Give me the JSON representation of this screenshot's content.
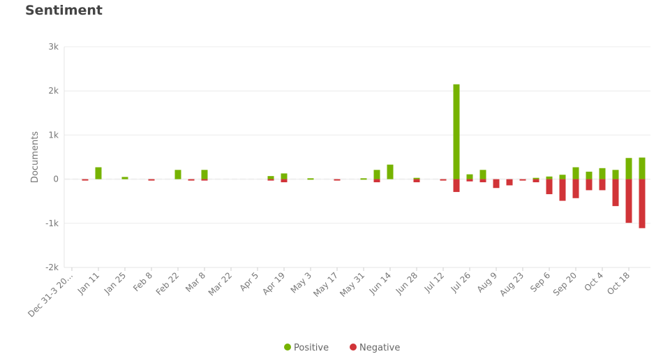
{
  "title": "Sentiment",
  "chart_data": {
    "type": "bar",
    "title": "Sentiment",
    "xlabel": "",
    "ylabel": "Documents",
    "ylim": [
      -2000,
      3000
    ],
    "yticks": [
      -2000,
      -1000,
      0,
      1000,
      2000,
      3000
    ],
    "ytick_labels": [
      "-2k",
      "-1k",
      "0",
      "1k",
      "2k",
      "3k"
    ],
    "grid": true,
    "legend_position": "bottom",
    "x_tick_labels": [
      "Dec 31-3 20...",
      "Jan 11",
      "Jan 25",
      "Feb 8",
      "Feb 22",
      "Mar 8",
      "Mar 22",
      "Apr 5",
      "Apr 19",
      "May 3",
      "May 17",
      "May 31",
      "Jun 14",
      "Jun 28",
      "Jul 12",
      "Jul 26",
      "Aug 9",
      "Aug 23",
      "Sep 6",
      "Sep 20",
      "Oct 4",
      "Oct 18"
    ],
    "series": [
      {
        "name": "Positive",
        "color": "#76b300",
        "values": [
          0,
          0,
          270,
          0,
          50,
          0,
          0,
          0,
          210,
          0,
          210,
          0,
          0,
          0,
          0,
          70,
          130,
          0,
          20,
          0,
          0,
          0,
          20,
          210,
          330,
          0,
          30,
          0,
          0,
          2150,
          110,
          210,
          0,
          0,
          0,
          30,
          60,
          100,
          270,
          170,
          250,
          210,
          480,
          490
        ]
      },
      {
        "name": "Negative",
        "color": "#d13438",
        "values": [
          0,
          -20,
          0,
          0,
          0,
          0,
          -20,
          0,
          0,
          -20,
          -30,
          0,
          0,
          0,
          0,
          -30,
          -70,
          0,
          0,
          0,
          -20,
          0,
          0,
          -70,
          0,
          0,
          -70,
          0,
          -20,
          -290,
          -50,
          -70,
          -200,
          -140,
          -20,
          -70,
          -340,
          -490,
          -430,
          -250,
          -250,
          -610,
          -990,
          -1110
        ]
      }
    ]
  }
}
